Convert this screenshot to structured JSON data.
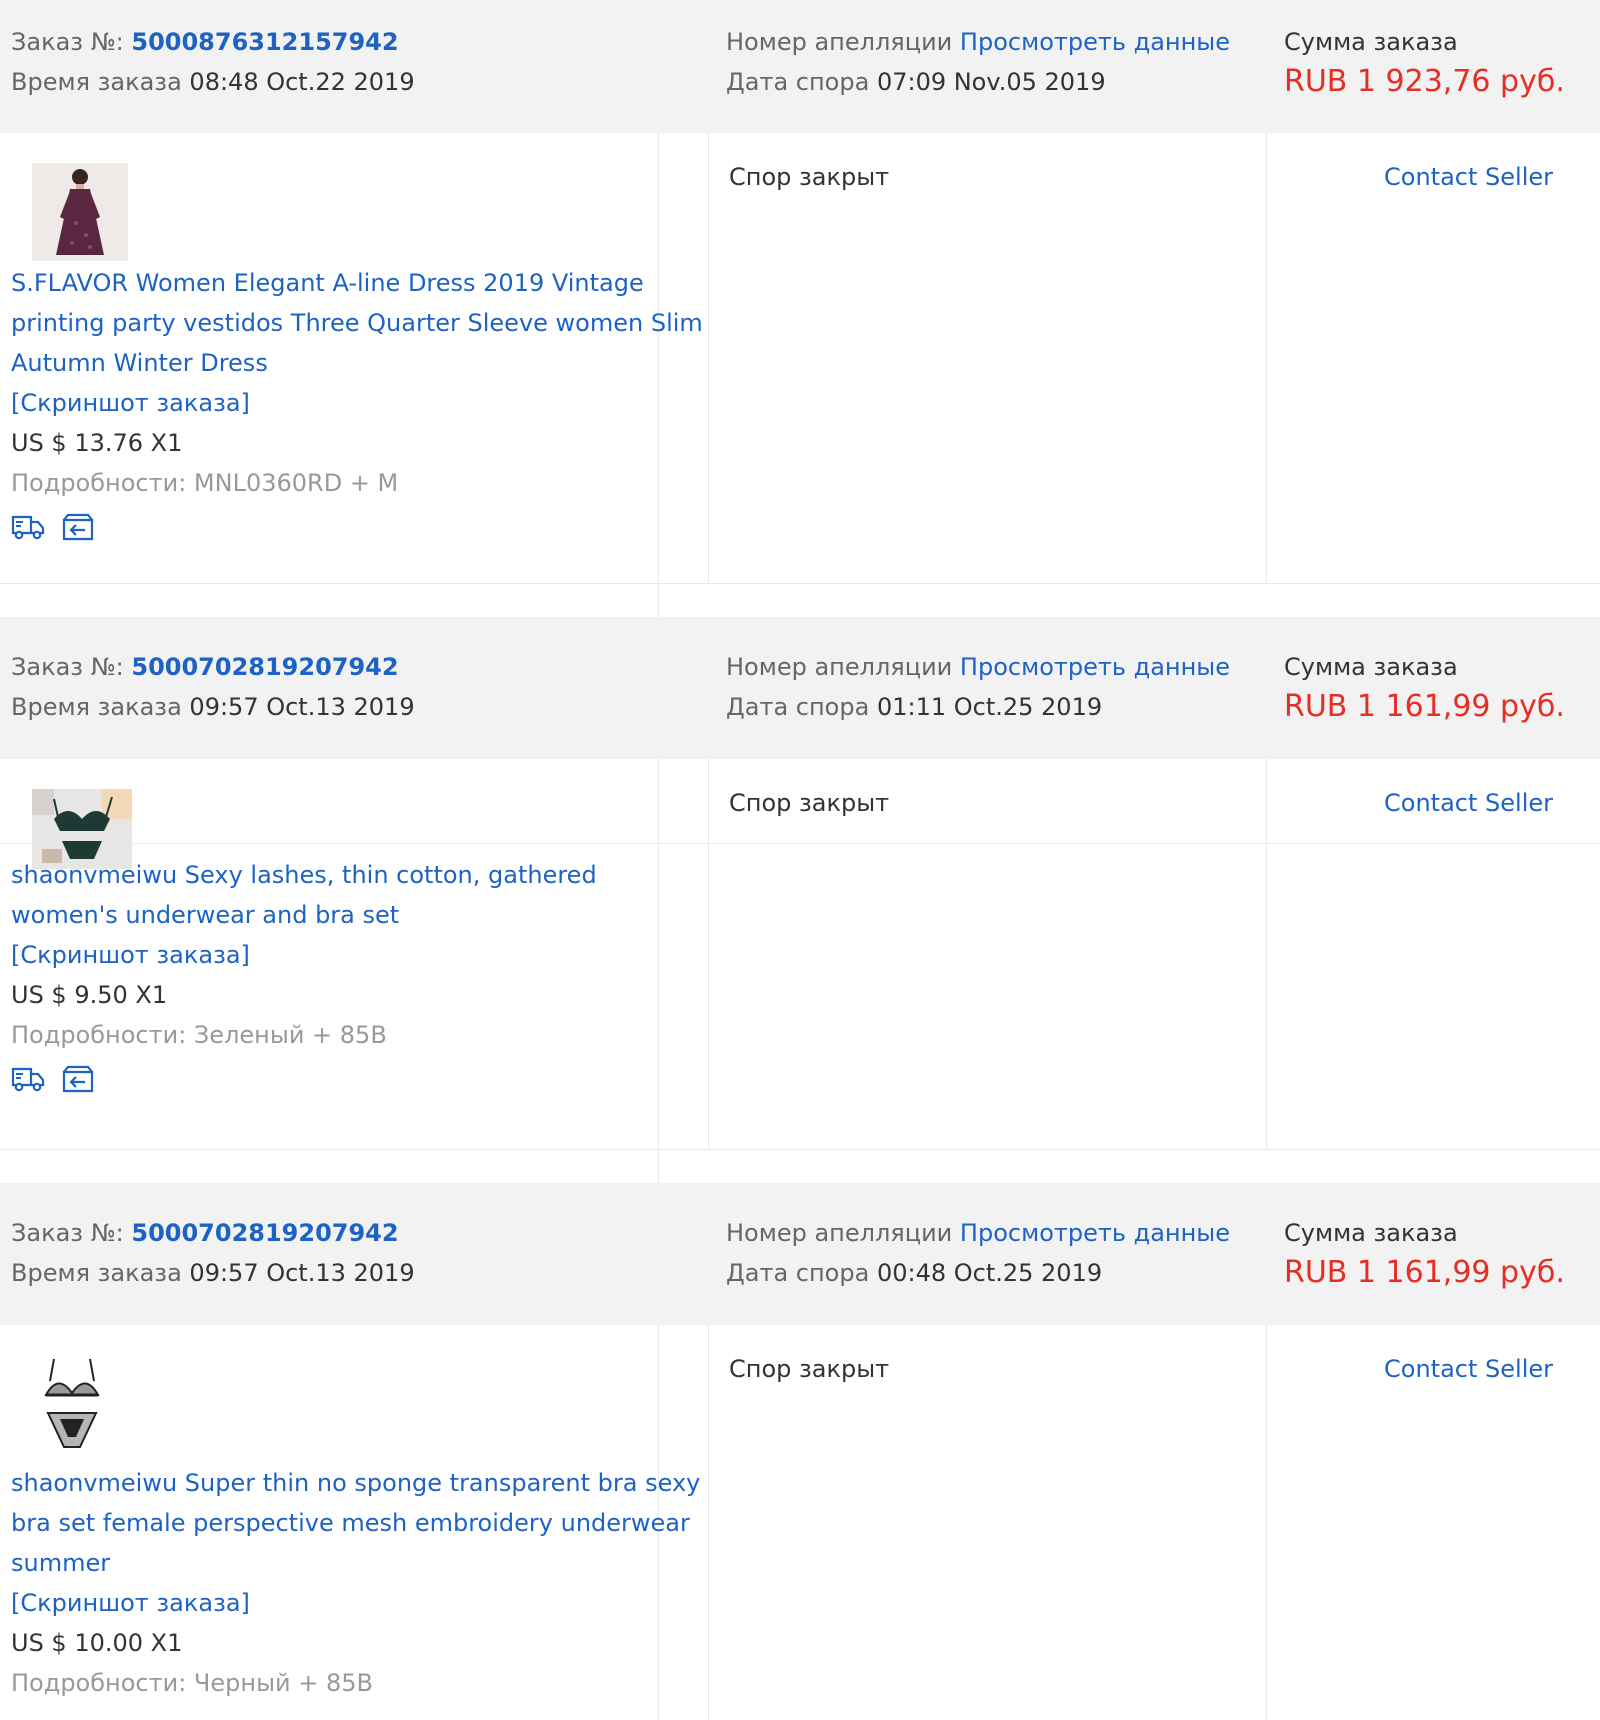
{
  "labels": {
    "order_no": "Заказ №:",
    "order_time": "Время заказа",
    "appeal_no": "Номер апелляции",
    "view_data": "Просмотреть данные",
    "dispute_date": "Дата спора",
    "order_sum": "Сумма заказа",
    "snapshot": "[Скриншот заказа]",
    "details": "Подробности:",
    "contact_seller": "Contact Seller"
  },
  "colors": {
    "link": "#1e63c4",
    "amount": "#e62e24",
    "header_bg": "#f2f2f2"
  },
  "orders": [
    {
      "order_number": "5000876312157942",
      "order_time": "08:48 Oct.22 2019",
      "dispute_date": "07:09 Nov.05 2019",
      "amount": "RUB 1 923,76 руб.",
      "status": "Спор закрыт",
      "product": {
        "image": "dress-photo",
        "title": "S.FLAVOR Women Elegant A-line Dress 2019 Vintage printing party vestidos Three Quarter Sleeve women Slim Autumn Winter Dress",
        "price": "US $ 13.76 X1",
        "details": "MNL0360RD + M"
      },
      "icons": [
        "shipping-truck-icon",
        "return-box-icon"
      ]
    },
    {
      "order_number": "5000702819207942",
      "order_time": "09:57 Oct.13 2019",
      "dispute_date": "01:11 Oct.25 2019",
      "amount": "RUB 1 161,99 руб.",
      "status": "Спор закрыт",
      "product": {
        "image": "lingerie-set-photo",
        "title": "shaonvmeiwu Sexy lashes, thin cotton, gathered women's underwear and bra set",
        "price": "US $ 9.50 X1",
        "details": "Зеленый + 85B"
      },
      "icons": [
        "shipping-truck-icon",
        "return-box-icon"
      ]
    },
    {
      "order_number": "5000702819207942",
      "order_time": "09:57 Oct.13 2019",
      "dispute_date": "00:48 Oct.25 2019",
      "amount": "RUB 1 161,99 руб.",
      "status": "Спор закрыт",
      "product": {
        "image": "mesh-bra-set-photo",
        "title": "shaonvmeiwu Super thin no sponge transparent bra sexy bra set female perspective mesh embroidery underwear summer",
        "price": "US $ 10.00 X1",
        "details": "Черный + 85B"
      },
      "icons": []
    }
  ]
}
